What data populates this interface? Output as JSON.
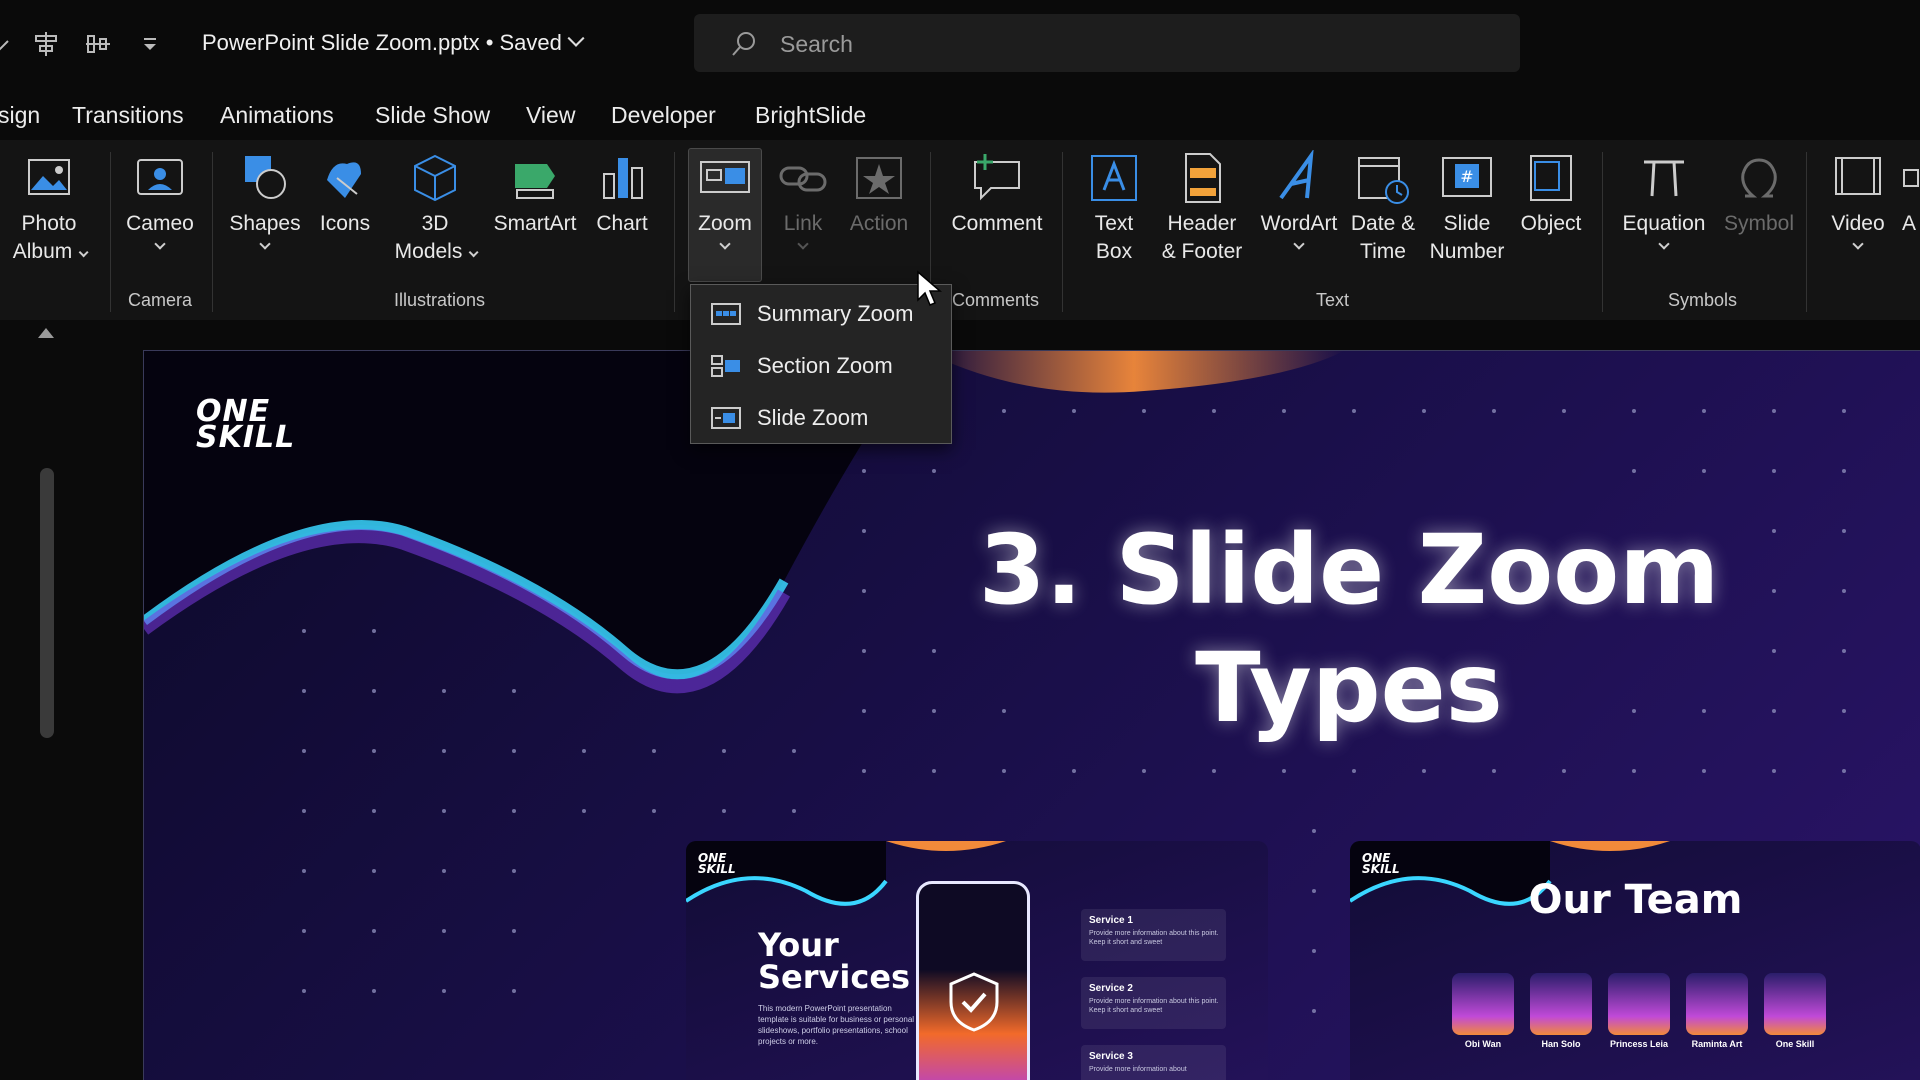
{
  "window": {
    "doc_title": "PowerPoint Slide Zoom.pptx • Saved",
    "search_placeholder": "Search"
  },
  "tabs": [
    "sign",
    "Transitions",
    "Animations",
    "Slide Show",
    "View",
    "Developer",
    "BrightSlide"
  ],
  "ribbon": {
    "buttons": {
      "photo_album": [
        "Photo",
        "Album"
      ],
      "cameo": "Cameo",
      "shapes": "Shapes",
      "icons": "Icons",
      "models_3d": [
        "3D",
        "Models"
      ],
      "smartart": "SmartArt",
      "chart": "Chart",
      "zoom": "Zoom",
      "link": "Link",
      "action": "Action",
      "comment": "Comment",
      "text_box": [
        "Text",
        "Box"
      ],
      "header_footer": [
        "Header",
        "& Footer"
      ],
      "wordart": "WordArt",
      "date_time": [
        "Date &",
        "Time"
      ],
      "slide_number": [
        "Slide",
        "Number"
      ],
      "object": "Object",
      "equation": "Equation",
      "symbol": "Symbol",
      "video": "Video",
      "cut_off": "A"
    },
    "groups": {
      "camera": "Camera",
      "illustrations": "Illustrations",
      "comments": "Comments",
      "text": "Text",
      "symbols": "Symbols"
    }
  },
  "zoom_menu": {
    "items": [
      "Summary Zoom",
      "Section Zoom",
      "Slide Zoom"
    ]
  },
  "slide": {
    "logo": [
      "ONE",
      "SKILL"
    ],
    "title_line1": "3. Slide Zoom",
    "title_line2": "Types",
    "services_thumb": {
      "logo": [
        "ONE",
        "SKILL"
      ],
      "title_line1": "Your",
      "title_line2": "Services",
      "description": "This modern PowerPoint presentation template is suitable for business or personal slideshows, portfolio presentations, school projects or more.",
      "cards": [
        {
          "title": "Service 1",
          "text": "Provide more information about this point. Keep it short and sweet"
        },
        {
          "title": "Service 2",
          "text": "Provide more information about this point. Keep it short and sweet"
        },
        {
          "title": "Service 3",
          "text": "Provide more information about"
        }
      ]
    },
    "team_thumb": {
      "logo": [
        "ONE",
        "SKILL"
      ],
      "title": "Our Team",
      "members": [
        "Obi Wan",
        "Han Solo",
        "Princess Leia",
        "Raminta Art",
        "One Skill"
      ]
    }
  },
  "colors": {
    "accent_blue": "#3a8ee6",
    "ribbon_bg": "#141414",
    "slide_glow_cyan": "#3ad6ff",
    "slide_glow_orange": "#f28a3a"
  }
}
